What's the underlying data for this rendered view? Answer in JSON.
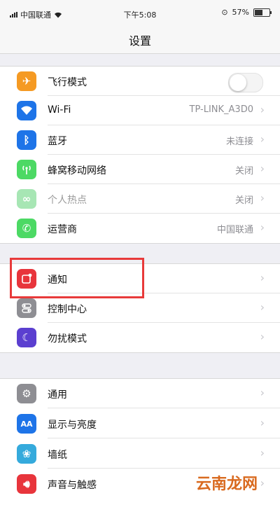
{
  "status_bar": {
    "carrier": "中国联通",
    "time": "下午5:08",
    "battery": "57%",
    "battery_level": 0.57
  },
  "nav": {
    "title": "设置"
  },
  "group1": [
    {
      "name": "airplane",
      "label": "飞行模式",
      "value": "",
      "icon": "airplane-icon",
      "color": "#f59a23",
      "toggle": true
    },
    {
      "name": "wifi",
      "label": "Wi-Fi",
      "value": "TP-LINK_A3D0",
      "icon": "wifi-icon",
      "color": "#1e74e8"
    },
    {
      "name": "bluetooth",
      "label": "蓝牙",
      "value": "未连接",
      "icon": "bluetooth-icon",
      "color": "#1e74e8"
    },
    {
      "name": "cellular",
      "label": "蜂窝移动网络",
      "value": "关闭",
      "icon": "antenna-icon",
      "color": "#4cd964"
    },
    {
      "name": "hotspot",
      "label": "个人热点",
      "value": "关闭",
      "icon": "hotspot-icon",
      "color": "#a7e6b4",
      "dimmed": true
    },
    {
      "name": "carrier",
      "label": "运营商",
      "value": "中国联通",
      "icon": "phone-icon",
      "color": "#4cd964"
    }
  ],
  "group2": [
    {
      "name": "notifications",
      "label": "通知",
      "icon": "notification-icon",
      "color": "#e8353c"
    },
    {
      "name": "control-center",
      "label": "控制中心",
      "icon": "switches-icon",
      "color": "#8e8e93"
    },
    {
      "name": "do-not-disturb",
      "label": "勿扰模式",
      "icon": "moon-icon",
      "color": "#5b3fd0"
    }
  ],
  "group3": [
    {
      "name": "general",
      "label": "通用",
      "icon": "gear-icon",
      "color": "#8e8e93"
    },
    {
      "name": "display",
      "label": "显示与亮度",
      "icon": "text-size-icon",
      "color": "#1e74e8",
      "glyph": "AA"
    },
    {
      "name": "wallpaper",
      "label": "墙纸",
      "icon": "flower-icon",
      "color": "#35aadc"
    },
    {
      "name": "sounds",
      "label": "声音与触感",
      "icon": "speaker-icon",
      "color": "#e8353c"
    }
  ],
  "watermark": "云南龙网"
}
